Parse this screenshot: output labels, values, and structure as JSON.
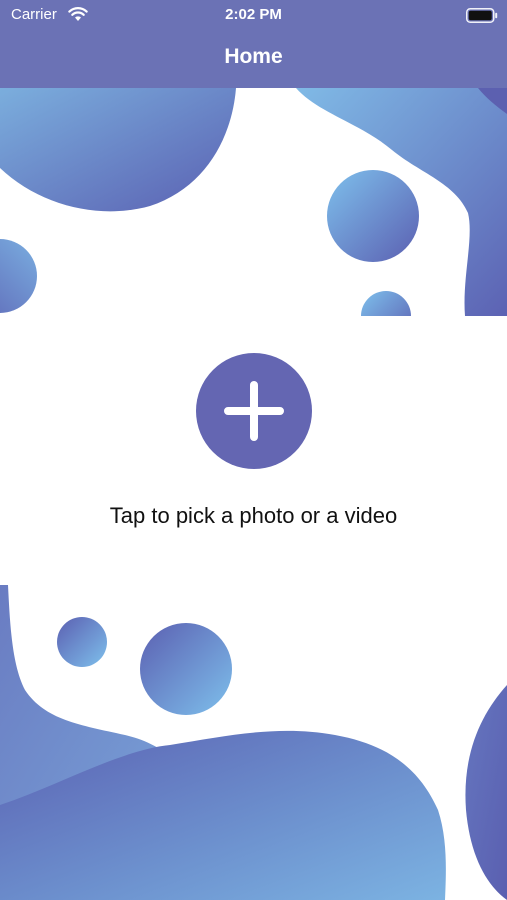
{
  "status_bar": {
    "carrier": "Carrier",
    "time": "2:02 PM",
    "wifi_icon": "wifi-icon",
    "battery_icon": "battery-icon"
  },
  "nav": {
    "title": "Home"
  },
  "main": {
    "add_icon": "plus-icon",
    "prompt": "Tap to pick a photo or a video"
  },
  "colors": {
    "nav_background": "#6b72b5",
    "accent": "#6466b2",
    "blob_light": "#7fb7e4",
    "blob_dark": "#5d63b4",
    "text": "#111111"
  }
}
